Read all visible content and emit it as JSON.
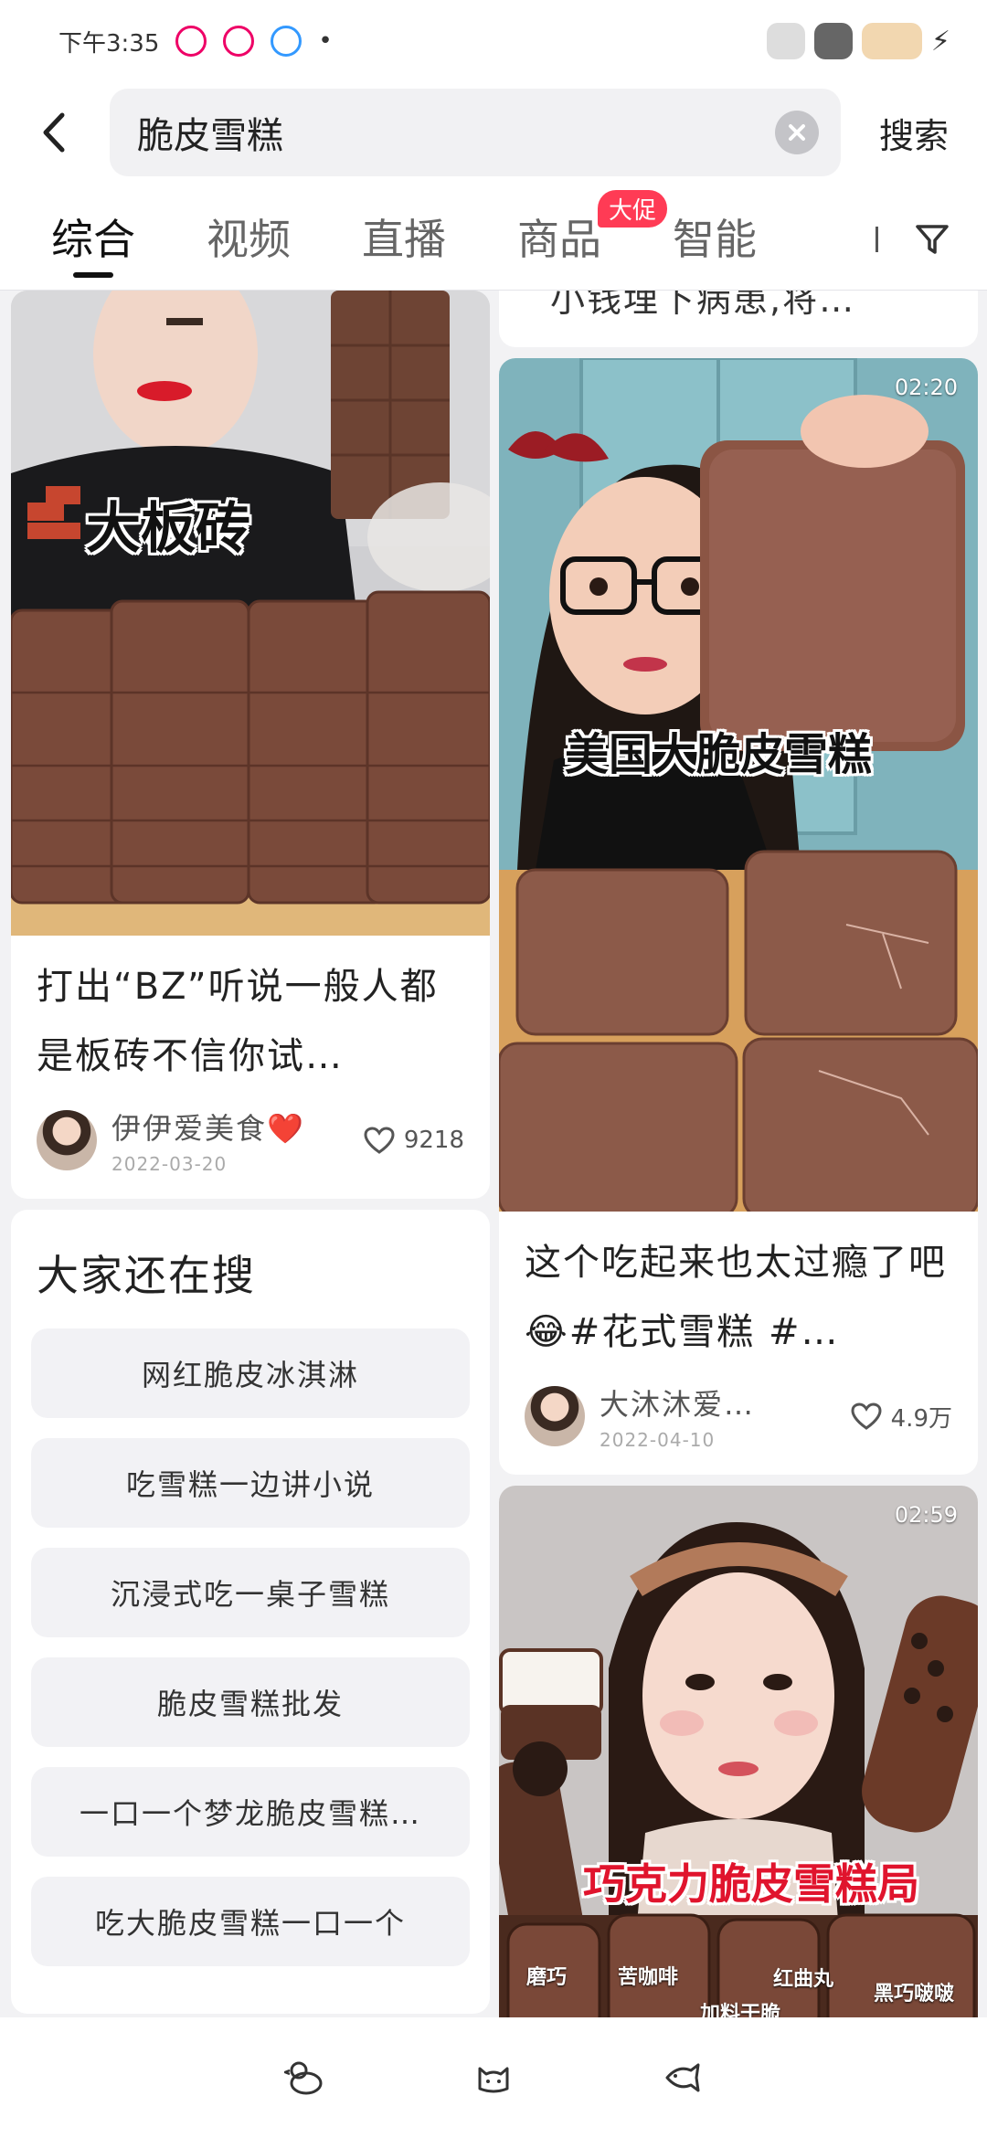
{
  "status_bar": {
    "time": "下午3:35",
    "dot": "•"
  },
  "search": {
    "query": "脆皮雪糕",
    "submit_label": "搜索"
  },
  "tabs": [
    {
      "label": "综合",
      "active": true
    },
    {
      "label": "视频"
    },
    {
      "label": "直播"
    },
    {
      "label": "商品",
      "badge": "大促"
    },
    {
      "label": "智能"
    }
  ],
  "left": {
    "card1": {
      "overlay": "大板砖",
      "title": "打出“BZ”听说一般人都是板砖不信你试…",
      "author": "伊伊爱美食❤️",
      "date": "2022-03-20",
      "likes": "9218"
    },
    "related": {
      "title": "大家还在搜",
      "items": [
        "网红脆皮冰淇淋",
        "吃雪糕一边讲小说",
        "沉浸式吃一桌子雪糕",
        "脆皮雪糕批发",
        "一口一个梦龙脆皮雪糕…",
        "吃大脆皮雪糕一口一个"
      ]
    }
  },
  "right": {
    "snippet": "小钱埋下病患,将…",
    "card1": {
      "duration": "02:20",
      "overlay": "美国大脆皮雪糕",
      "title": "这个吃起来也太过瘾了吧😂#花式雪糕 #…",
      "author": "大沐沐爱…",
      "date": "2022-04-10",
      "likes": "4.9万"
    },
    "card2": {
      "duration": "02:59",
      "overlay": "巧克力脆皮雪糕局",
      "labels": [
        "磨巧",
        "苦咖啡",
        "红曲丸",
        "黑巧啵啵",
        "加料干脆"
      ]
    }
  }
}
